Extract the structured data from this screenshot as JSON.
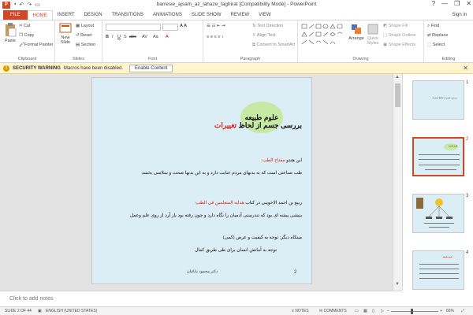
{
  "titlebar": {
    "title": "barresie_ajsam_az_lahaze_taghirat [Compatibility Mode] - PowerPoint",
    "app_icon": "P",
    "qat_icons": [
      "save-icon",
      "undo-icon",
      "redo-icon",
      "present-icon"
    ],
    "controls": {
      "help": "?",
      "minimize": "—",
      "restore": "❐",
      "close": "✕"
    }
  },
  "tabs": [
    {
      "label": "FILE"
    },
    {
      "label": "HOME"
    },
    {
      "label": "INSERT"
    },
    {
      "label": "DESIGN"
    },
    {
      "label": "TRANSITIONS"
    },
    {
      "label": "ANIMATIONS"
    },
    {
      "label": "SLIDE SHOW"
    },
    {
      "label": "REVIEW"
    },
    {
      "label": "VIEW"
    }
  ],
  "signin": "Sign in",
  "ribbon": {
    "clipboard": {
      "label": "Clipboard",
      "paste": "Paste",
      "cut": "Cut",
      "copy": "Copy",
      "format_painter": "Format Painter"
    },
    "slides": {
      "label": "Slides",
      "new_slide": "New Slide",
      "layout": "Layout",
      "reset": "Reset",
      "section": "Section"
    },
    "font": {
      "label": "Font"
    },
    "paragraph": {
      "label": "Paragraph",
      "text_direction": "Text Direction",
      "align_text": "Align Text",
      "smartart": "Convert to SmartArt"
    },
    "drawing": {
      "label": "Drawing",
      "arrange": "Arrange",
      "quick_styles": "Quick Styles",
      "shape_fill": "Shape Fill",
      "shape_outline": "Shape Outline",
      "shape_effects": "Shape Effects"
    },
    "editing": {
      "label": "Editing",
      "find": "Find",
      "replace": "Replace",
      "select": "Select"
    }
  },
  "security": {
    "title": "SECURITY WARNING",
    "message": "Macros have been disabled.",
    "button": "Enable Content"
  },
  "slide": {
    "oval_text": "علوم طبیعه",
    "title_main": "بررسی جسم از لحاظ",
    "title_red": "تغییرات",
    "line1_prefix": "ابن هندو",
    "line1_red": "مفتاح الطب:",
    "line2": "طب صناعتی است که به بدنهای مردم عنایت دارد و به این بدنها صحت و سلامتی بخشد",
    "line3_prefix": "ربیع بن احمد الاخوینی در کتاب",
    "line3_red": "هدایه المتعلمین فی الطب:",
    "line4": "بنیشی پیشه ای بود که تندرستی آدمیان را نگاه دارد و چون رفته بود باز آرد از روی علم وعمل",
    "line5": "میتکاه دیگر: توجه به کیفیت و عرض (کمی)",
    "line6": "توجه به آماتش انسان برای طی طریق کمال",
    "author": "دکتر محمود بابائیان",
    "number": "2"
  },
  "thumbnails": [
    {
      "num": "1",
      "text": "بررسی جسم از لحاظ تغییرات"
    },
    {
      "num": "2",
      "text": "علوم طبیعه"
    },
    {
      "num": "3",
      "text": ""
    },
    {
      "num": "4",
      "text": "علوم طبیعه"
    }
  ],
  "notes": {
    "placeholder": "Click to add notes"
  },
  "status": {
    "slide": "SLIDE 2 OF 44",
    "language": "ENGLISH (UNITED STATES)",
    "notes": "NOTES",
    "comments": "COMMENTS",
    "zoom": "66%"
  },
  "colors": {
    "accent": "#d24726",
    "slide_bg": "#dbeef6",
    "title_red": "#e0231d",
    "oval_green": "#c6e9a4",
    "security_bg": "#fff4ce"
  }
}
